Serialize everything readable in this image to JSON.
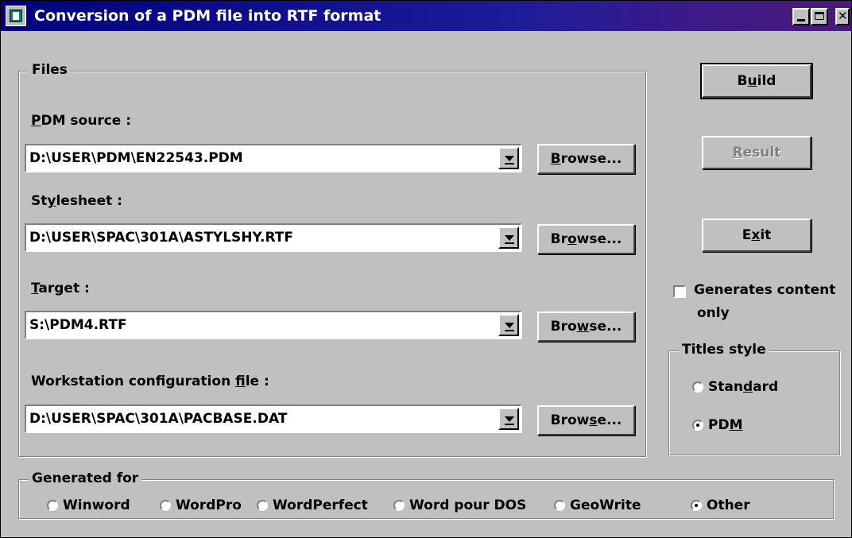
{
  "window": {
    "title": "Conversion of a PDM file into RTF format"
  },
  "files": {
    "legend": "Files",
    "pdm_source": {
      "label_accel": "P",
      "label_rest": "DM source :",
      "value": "D:\\USER\\PDM\\EN22543.PDM",
      "browse_pre": "",
      "browse_accel": "B",
      "browse_post": "rowse..."
    },
    "stylesheet": {
      "label_pre": "St",
      "label_accel": "y",
      "label_post": "lesheet :",
      "value": "D:\\USER\\SPAC\\301A\\ASTYLSHY.RTF",
      "browse_pre": "Br",
      "browse_accel": "o",
      "browse_post": "wse..."
    },
    "target": {
      "label_accel": "T",
      "label_rest": "arget :",
      "value": "S:\\PDM4.RTF",
      "browse_pre": "Bro",
      "browse_accel": "w",
      "browse_post": "se..."
    },
    "workstation": {
      "label_pre": "Workstation configuration ",
      "label_accel": "f",
      "label_post": "ile :",
      "value": "D:\\USER\\SPAC\\301A\\PACBASE.DAT",
      "browse_pre": "Brow",
      "browse_accel": "s",
      "browse_post": "e..."
    }
  },
  "actions": {
    "build_pre": "B",
    "build_accel": "u",
    "build_post": "ild",
    "result_accel": "R",
    "result_post": "esult",
    "exit_pre": "E",
    "exit_accel": "x",
    "exit_post": "it"
  },
  "options": {
    "generates_content_line1": "Generates content",
    "generates_content_line2": "only",
    "generates_content_checked": false
  },
  "titles_style": {
    "legend": "Titles style",
    "standard_pre": "Stan",
    "standard_accel": "d",
    "standard_post": "ard",
    "pdm_pre": "PD",
    "pdm_accel": "M",
    "selected": "PDM"
  },
  "generated_for": {
    "legend": "Generated for",
    "options": [
      "Winword",
      "WordPro",
      "WordPerfect",
      "Word pour DOS",
      "GeoWrite",
      "Other"
    ],
    "selected": "Other"
  }
}
